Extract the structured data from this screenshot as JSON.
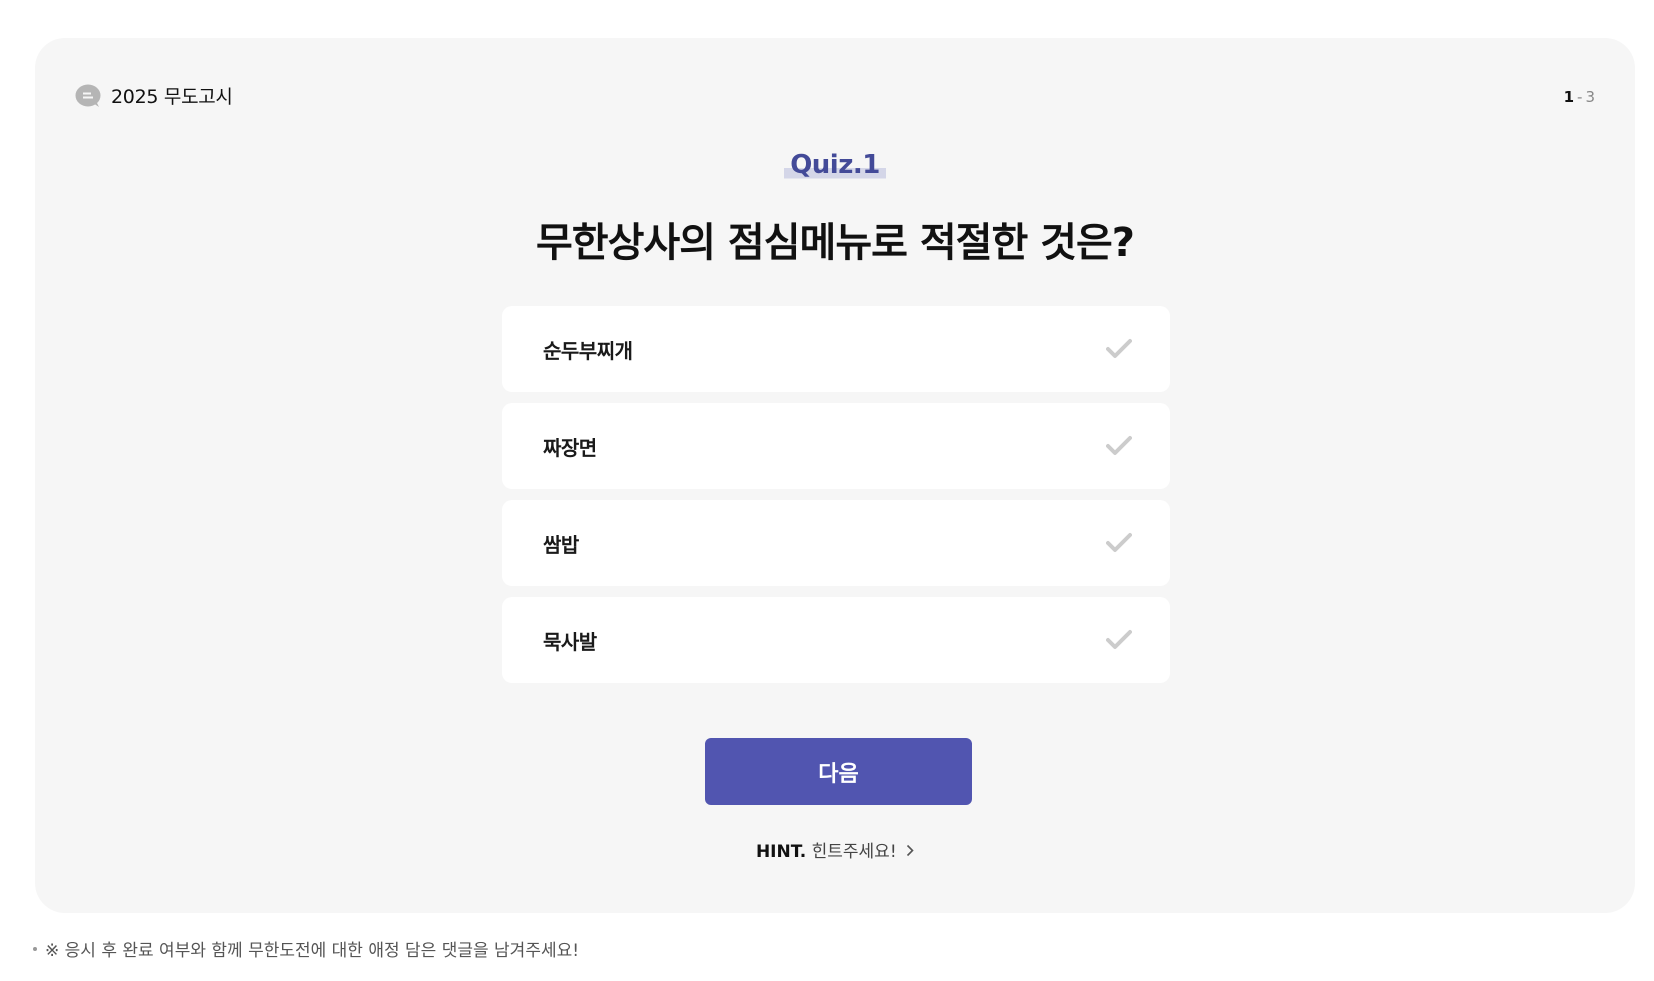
{
  "header": {
    "brand_label": "2025 무도고시",
    "brand_icon": "speech-bubble-icon",
    "counter_current": "1",
    "counter_separator": "-",
    "counter_total": "3"
  },
  "quiz": {
    "tag": "Quiz.1",
    "question": "무한상사의 점심메뉴로 적절한 것은?",
    "options": [
      {
        "label": "순두부찌개",
        "icon": "check-icon"
      },
      {
        "label": "짜장면",
        "icon": "check-icon"
      },
      {
        "label": "쌈밥",
        "icon": "check-icon"
      },
      {
        "label": "묵사발",
        "icon": "check-icon"
      }
    ],
    "next_label": "다음",
    "hint_key": "HINT.",
    "hint_text": "힌트주세요!"
  },
  "footer": {
    "note": "※ 응시 후 완료 여부와 함께 무한도전에 대한 애정 담은 댓글을 남겨주세요!"
  },
  "colors": {
    "accent": "#5155b0",
    "quiz_tag": "#434a98",
    "card_bg": "#f6f6f6",
    "check_inactive": "#cccccc"
  }
}
